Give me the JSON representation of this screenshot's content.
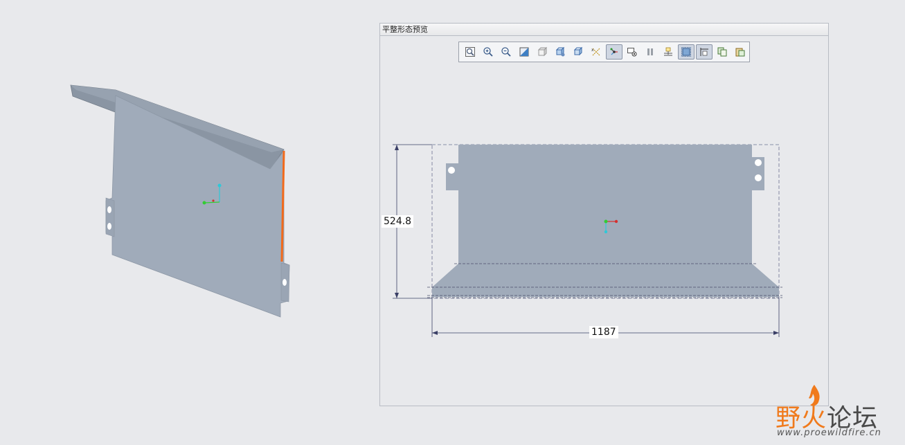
{
  "preview_window": {
    "title": "平整形态预览"
  },
  "toolbar": {
    "buttons": [
      {
        "name": "refit-icon",
        "active": false
      },
      {
        "name": "zoom-in-icon",
        "active": false
      },
      {
        "name": "zoom-out-icon",
        "active": false
      },
      {
        "name": "repaint-icon",
        "active": false
      },
      {
        "name": "display-style-icon",
        "active": false
      },
      {
        "name": "saved-views-icon",
        "active": false
      },
      {
        "name": "orient-view-icon",
        "active": false
      },
      {
        "name": "datum-display-icon",
        "active": false
      },
      {
        "name": "spin-center-icon",
        "active": true
      },
      {
        "name": "view-manager-icon",
        "active": false
      },
      {
        "name": "pause-icon",
        "active": false
      },
      {
        "name": "annotation-display-icon",
        "active": false
      },
      {
        "name": "bounding-box-icon",
        "active": true
      },
      {
        "name": "dimension-display-icon",
        "active": true
      },
      {
        "name": "copy-icon",
        "active": false
      },
      {
        "name": "paste-icon",
        "active": false
      }
    ]
  },
  "dimensions": {
    "height": "524.8",
    "width": "1187"
  },
  "colors": {
    "part": "#a0abba",
    "edge_highlight": "#f26a1b",
    "dim_line": "#3a3f66"
  },
  "watermark": {
    "title_part1": "野火",
    "title_part2": "论坛",
    "url": "www.proewildfire.cn"
  }
}
